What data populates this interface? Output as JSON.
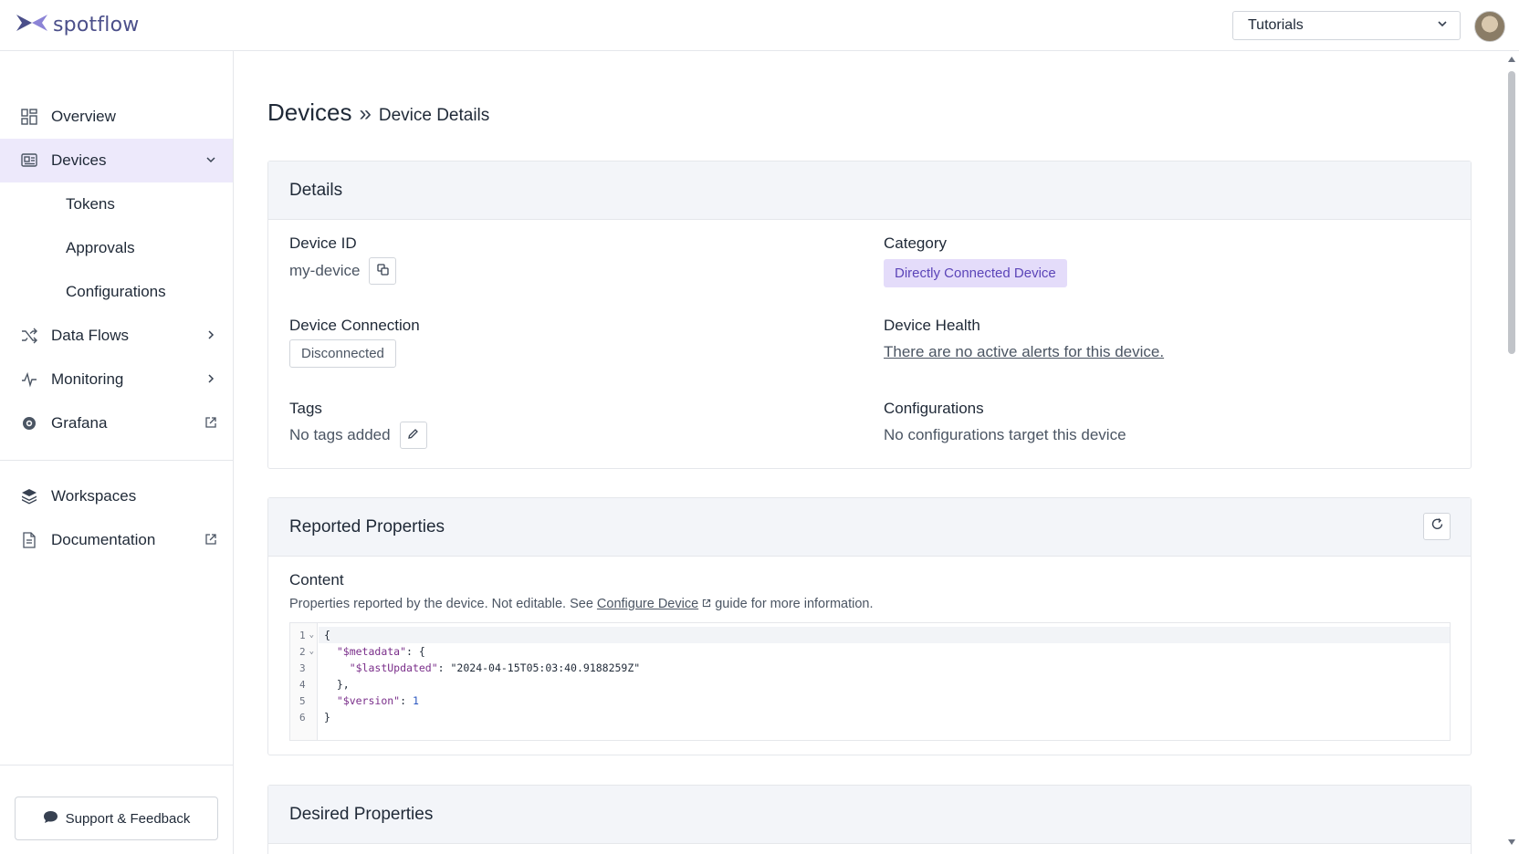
{
  "brand": {
    "logo_text": "spotflow",
    "logo_icon": "spotflow-logo-icon",
    "accent": "#6d55c8"
  },
  "header": {
    "workspace_selected": "Tutorials",
    "workspace_icon": "chevron-down-icon"
  },
  "sidebar": {
    "items": [
      {
        "label": "Overview",
        "icon": "grid-icon"
      },
      {
        "label": "Devices",
        "icon": "device-icon",
        "trail": "chevron-down-icon",
        "active": true
      },
      {
        "label": "Tokens"
      },
      {
        "label": "Approvals"
      },
      {
        "label": "Configurations"
      },
      {
        "label": "Data Flows",
        "icon": "shuffle-icon",
        "trail": "chevron-right-icon"
      },
      {
        "label": "Monitoring",
        "icon": "pulse-icon",
        "trail": "chevron-right-icon"
      },
      {
        "label": "Grafana",
        "icon": "grafana-icon",
        "trail": "external-link-icon"
      },
      {
        "label": "Workspaces",
        "icon": "layers-icon"
      },
      {
        "label": "Documentation",
        "icon": "document-icon",
        "trail": "external-link-icon"
      }
    ],
    "support_label": "Support & Feedback"
  },
  "page": {
    "title": "Devices",
    "separator": "»",
    "subtitle": "Device Details"
  },
  "details": {
    "heading": "Details",
    "device_id_label": "Device ID",
    "device_id_value": "my-device",
    "category_label": "Category",
    "category_value": "Directly Connected Device",
    "connection_label": "Device Connection",
    "connection_value": "Disconnected",
    "health_label": "Device Health",
    "health_value": "There are no active alerts for this device.",
    "tags_label": "Tags",
    "tags_value": "No tags added",
    "configs_label": "Configurations",
    "configs_value": "No configurations target this device"
  },
  "reported": {
    "heading": "Reported Properties",
    "content_label": "Content",
    "desc_prefix": "Properties reported by the device. Not editable. See ",
    "desc_link": "Configure Device",
    "desc_suffix": " guide for more information.",
    "line_numbers": [
      "1",
      "2",
      "3",
      "4",
      "5",
      "6"
    ],
    "lines": [
      {
        "text": "{"
      },
      {
        "indent": "  ",
        "key": "\"$metadata\"",
        "rest": ": {"
      },
      {
        "indent": "    ",
        "key": "\"$lastUpdated\"",
        "rest": ": ",
        "str": "\"2024-04-15T05:03:40.9188259Z\""
      },
      {
        "text": "  },"
      },
      {
        "indent": "  ",
        "key": "\"$version\"",
        "rest": ": ",
        "num": "1"
      },
      {
        "text": "}"
      }
    ]
  },
  "desired": {
    "heading": "Desired Properties"
  }
}
